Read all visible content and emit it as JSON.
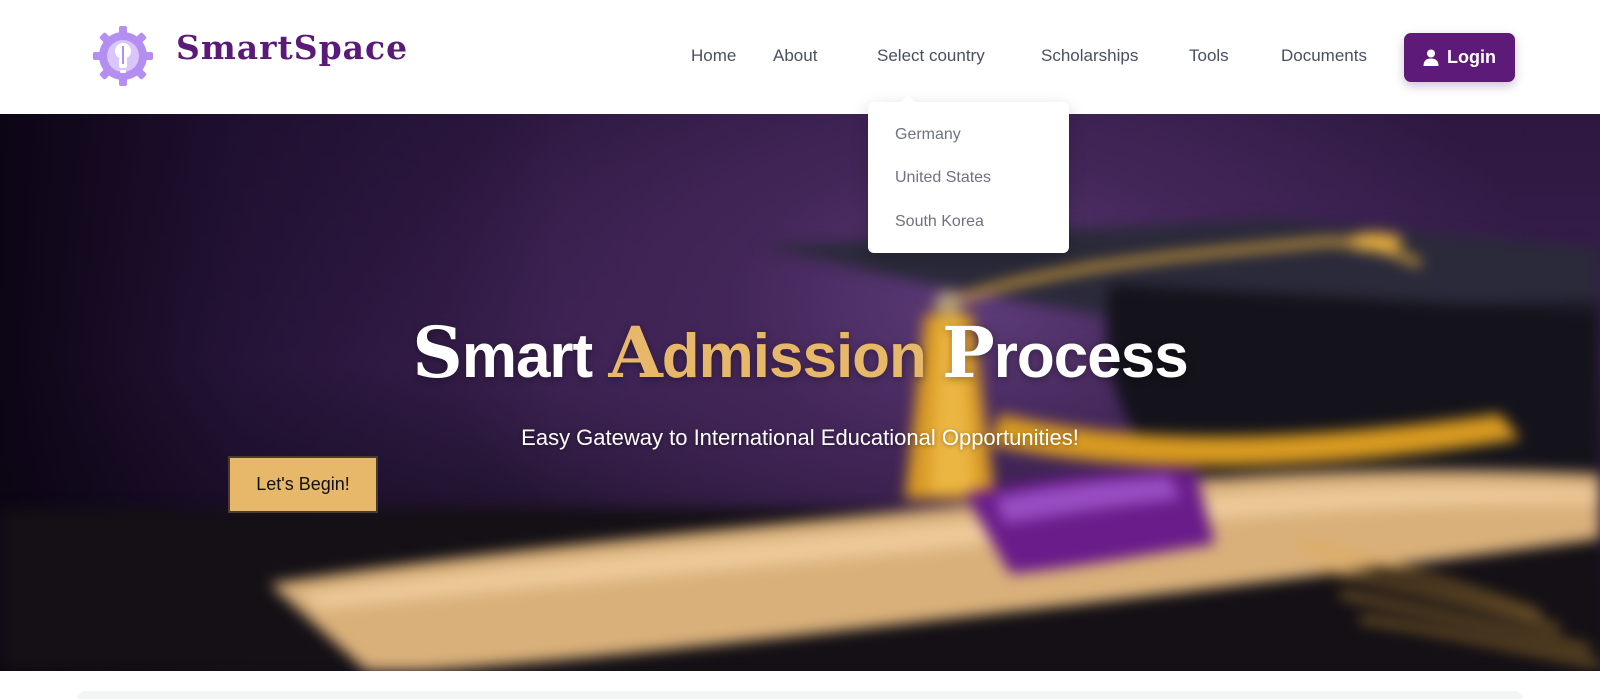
{
  "brand": {
    "name": "SmartSpace"
  },
  "nav": {
    "items": [
      {
        "label": "Home"
      },
      {
        "label": "About"
      },
      {
        "label": "Select country"
      },
      {
        "label": "Scholarships"
      },
      {
        "label": "Tools"
      },
      {
        "label": "Documents"
      }
    ],
    "login_label": "Login",
    "login_icon": "user-icon"
  },
  "dropdown": {
    "items": [
      {
        "label": "Germany"
      },
      {
        "label": "United States"
      },
      {
        "label": "South Korea"
      }
    ]
  },
  "hero": {
    "title": {
      "w1_cap": "S",
      "w1_rest": "mart",
      "w2_cap": "A",
      "w2_rest": "dmission",
      "w3_cap": "P",
      "w3_rest": "rocess"
    },
    "subtitle": "Easy Gateway to International Educational Opportunities!",
    "cta_label": "Let's Begin!"
  },
  "colors": {
    "brand_purple": "#5e1a78",
    "accent_gold": "#e8b86a",
    "nav_text": "#4a4f63",
    "dropdown_text": "#6d7380"
  }
}
